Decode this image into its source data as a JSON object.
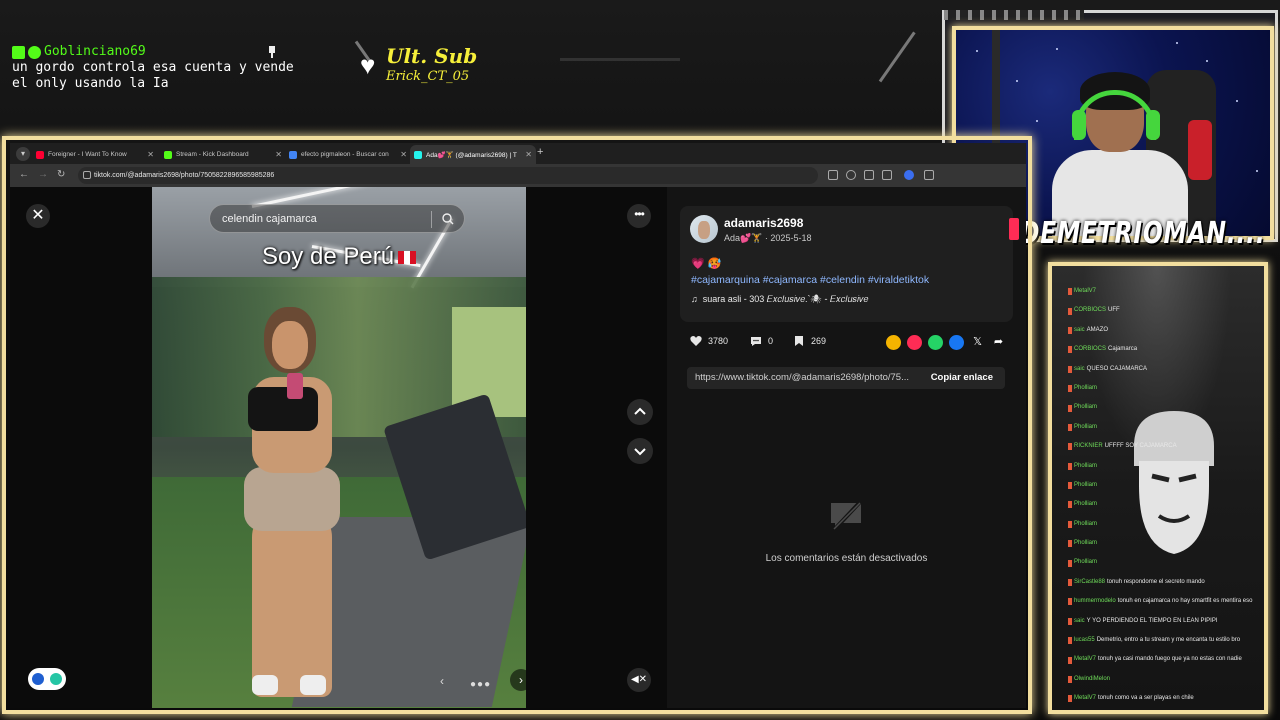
{
  "overlay": {
    "pinned_chat": {
      "username": "Goblinciano69",
      "message": "un gordo controla esa cuenta y vende\nel only usando la Ia"
    },
    "last_sub": {
      "title": "Ult. Sub",
      "name": "Erick_CT_05"
    },
    "streamer_name": "DEMETRIOMAN...."
  },
  "side_chat": {
    "rows": [
      {
        "user": "MetalV7",
        "text": ""
      },
      {
        "user": "CORBIOCS",
        "text": "UFF"
      },
      {
        "user": "saic",
        "text": "AMAZO"
      },
      {
        "user": "CORBIOCS",
        "text": "Cajamarca"
      },
      {
        "user": "saic",
        "text": "QUESO CAJAMARCA"
      },
      {
        "user": "Pholliam",
        "text": ""
      },
      {
        "user": "Pholliam",
        "text": ""
      },
      {
        "user": "Pholliam",
        "text": ""
      },
      {
        "user": "RICKNIER",
        "text": "UFFFF SOY CAJAMARCA"
      },
      {
        "user": "Pholliam",
        "text": ""
      },
      {
        "user": "Pholliam",
        "text": ""
      },
      {
        "user": "Pholliam",
        "text": ""
      },
      {
        "user": "Pholliam",
        "text": ""
      },
      {
        "user": "Pholliam",
        "text": ""
      },
      {
        "user": "Pholliam",
        "text": ""
      },
      {
        "user": "SirCastle88",
        "text": "tonuh respondome el secreto mando"
      },
      {
        "user": "hummermodelo",
        "text": "tonuh en cajamarca no hay smartfit es mentira eso"
      },
      {
        "user": "saic",
        "text": "Y YO PERDIENDO EL TIEMPO EN LEAN PIPIPI"
      },
      {
        "user": "lucas55",
        "text": "Demetrio, entro a tu stream y me encanta tu estilo bro"
      },
      {
        "user": "MetalV7",
        "text": "tonuh ya casi mando fuego que ya no estas con nadie"
      },
      {
        "user": "OlwindiMelon",
        "text": ""
      },
      {
        "user": "MetalV7",
        "text": "tonuh como va a ser playas en chile"
      }
    ]
  },
  "browser": {
    "tabs": [
      {
        "label": "Foreigner - I Want To Know",
        "fav_color": "#ff0033",
        "active": false
      },
      {
        "label": "Stream - Kick Dashboard",
        "fav_color": "#53fc18",
        "active": false
      },
      {
        "label": "efecto pigmaleon - Buscar con",
        "fav_color": "#4285f4",
        "active": false
      },
      {
        "label": "Ada💕🏋 (@adamaris2698) | T",
        "fav_color": "#25f4ee",
        "active": true
      }
    ],
    "url": "tiktok.com/@adamaris2698/photo/7505822896585985286"
  },
  "post": {
    "search_value": "celendin cajamarca",
    "caption": "Soy de Perú",
    "username": "adamaris2698",
    "subtitle": "Ada💕🏋 · 2025-5-18",
    "emoji_line": "💗 🥵",
    "hashtags": "#cajamarquina #cajamarca #celendin #viraldetiktok",
    "music": "suara asli - 303 𝐸𝑥𝑐𝑙𝑢𝑠𝑖𝑣𝑒.`🕷 - 𝐸𝑥𝑐𝑙𝑢𝑠𝑖𝑣𝑒",
    "likes": "3780",
    "comments": "0",
    "saves": "269",
    "share_link": "https://www.tiktok.com/@adamaris2698/photo/75...",
    "copy_label": "Copiar enlace",
    "no_comments": "Los comentarios están desactivados"
  },
  "colors": {
    "frame_glow": "#f2de9e",
    "kick_green": "#53fc18",
    "sub_yellow": "#f6ef3a",
    "hashtag": "#8fb8ff"
  }
}
